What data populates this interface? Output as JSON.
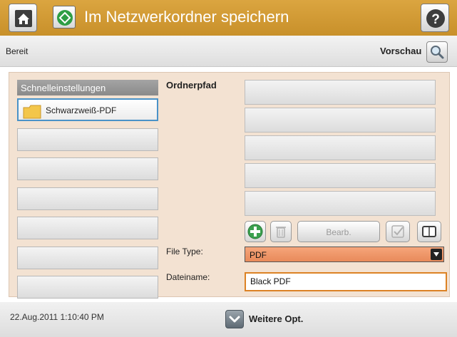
{
  "header": {
    "title": "Im Netzwerkordner speichern",
    "home_icon": "home-icon",
    "title_icon": "network-folder-save-icon",
    "help_icon": "help-icon",
    "bar_color": "#d39c34"
  },
  "status": {
    "text": "Bereit",
    "preview_label": "Vorschau",
    "preview_icon": "magnifier-icon"
  },
  "quick_settings": {
    "title": "Schnelleinstellungen",
    "items": [
      {
        "label": "Schwarzweiß-PDF",
        "icon": "folder-icon",
        "selected": true
      },
      {
        "label": ""
      },
      {
        "label": ""
      },
      {
        "label": ""
      },
      {
        "label": ""
      },
      {
        "label": ""
      },
      {
        "label": ""
      },
      {
        "label": ""
      }
    ]
  },
  "folder_path": {
    "label": "Ordnerpfad",
    "rows": [
      "",
      "",
      "",
      "",
      ""
    ]
  },
  "actions": {
    "add_icon": "plus-icon",
    "delete_icon": "trash-icon",
    "edit_label": "Bearb.",
    "ok_icon": "checkmark-icon",
    "book_icon": "address-book-icon"
  },
  "fields": {
    "file_type_label": "File Type:",
    "file_type_value": "PDF",
    "filename_label": "Dateiname:",
    "filename_value": "Black PDF",
    "select_color": "#f19a6d",
    "input_border_color": "#dc8224"
  },
  "footer": {
    "timestamp": "22.Aug.2011 1:10:40 PM",
    "more_label": "Weitere Opt.",
    "more_icon": "chevron-down-icon"
  }
}
